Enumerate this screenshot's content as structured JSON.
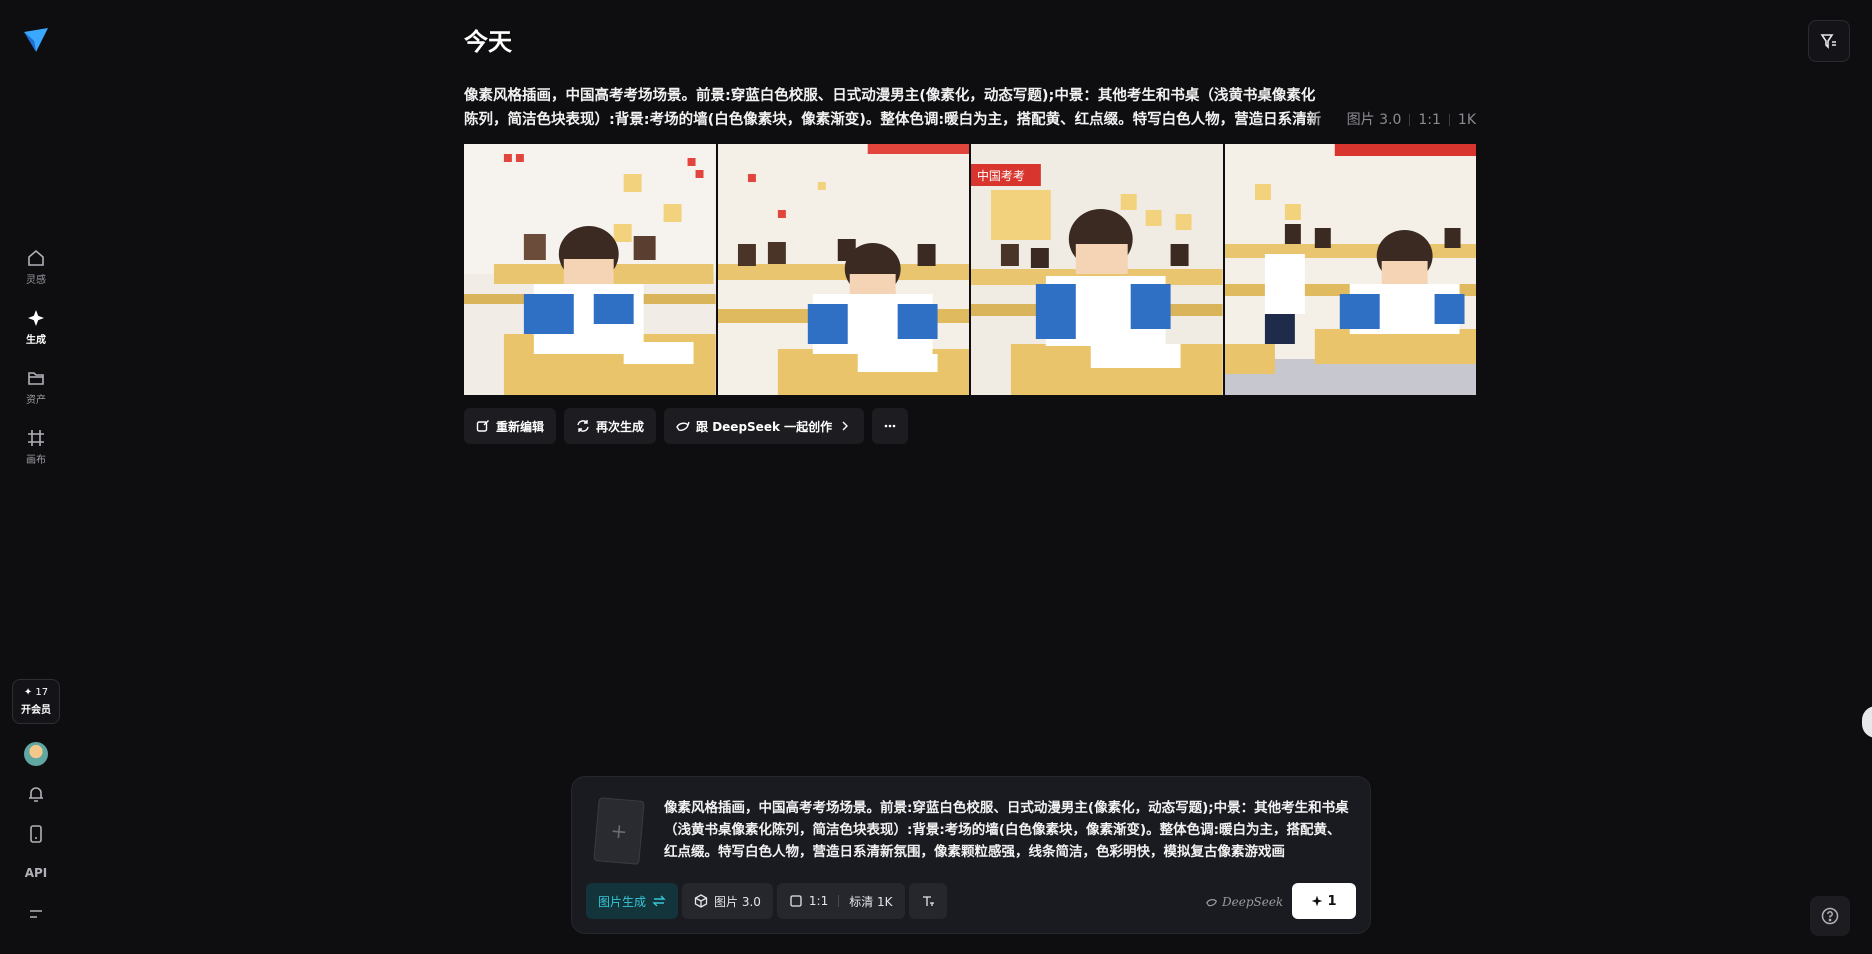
{
  "sidebar": {
    "nav": [
      {
        "label": "灵感",
        "icon": "home-icon"
      },
      {
        "label": "生成",
        "icon": "sparkle-icon",
        "active": true
      },
      {
        "label": "资产",
        "icon": "folder-icon"
      },
      {
        "label": "画布",
        "icon": "frame-icon"
      }
    ],
    "credits": "17",
    "member_label": "开会员",
    "api_label": "API"
  },
  "header": {
    "title": "今天"
  },
  "result": {
    "prompt": "像素风格插画，中国高考考场场景。前景:穿蓝白色校服、日式动漫男主(像素化，动态写题);中景：其他考生和书桌（浅黄书桌像素化陈列，简洁色块表现）:背景:考场的墙(白色像素块，像素渐变)。整体色调:暖白为主，搭配黄、红点缀。特写白色人物，营造日系清新氛围，像素颗粒感强，线条简洁，色彩明快，模拟复古像素游戏画",
    "model": "图片 3.0",
    "ratio": "1:1",
    "resolution": "1K",
    "images": [
      {
        "banner": ""
      },
      {
        "banner": ""
      },
      {
        "banner": "中国考考"
      },
      {
        "banner": ""
      }
    ],
    "actions": {
      "reedit": "重新编辑",
      "regenerate": "再次生成",
      "deepseek": "跟 DeepSeek 一起创作"
    }
  },
  "composer": {
    "text": "像素风格插画，中国高考考场场景。前景:穿蓝白色校服、日式动漫男主(像素化，动态写题);中景：其他考生和书桌（浅黄书桌像素化陈列，简洁色块表现）:背景:考场的墙(白色像素块，像素渐变)。整体色调:暖白为主，搭配黄、红点缀。特写白色人物，营造日系清新氛围，像素颗粒感强，线条简洁，色彩明快，模拟复古像素游戏画",
    "mode": "图片生成",
    "model": "图片 3.0",
    "ratio": "1:1",
    "quality": "标清 1K",
    "deepseek_label": "DeepSeek",
    "generate_count": "1"
  },
  "colors": {
    "accent": "#34c7d8",
    "bg": "#0e0e10",
    "panel": "#1a1b20"
  }
}
